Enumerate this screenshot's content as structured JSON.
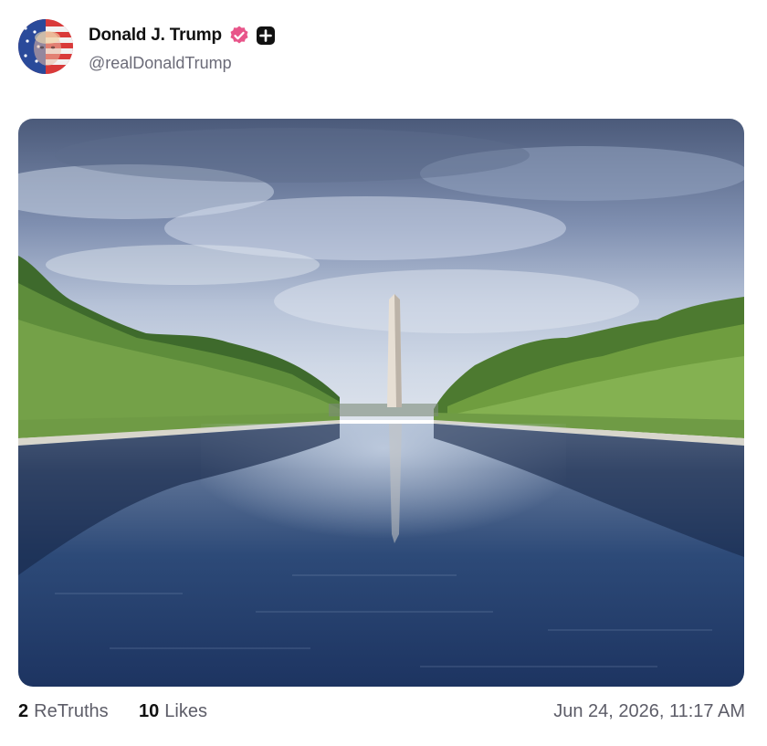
{
  "post": {
    "author": {
      "display_name": "Donald J. Trump",
      "handle": "@realDonaldTrump",
      "verified_badge_color": "#e8558a",
      "avatar_icon": "flag-portrait-avatar"
    },
    "media": {
      "alt": "Washington Monument reflected in the Lincoln Memorial Reflecting Pool"
    },
    "stats": {
      "retruths_count": "2",
      "retruths_label": "ReTruths",
      "likes_count": "10",
      "likes_label": "Likes"
    },
    "timestamp": "Jun 24, 2026, 11:17 AM"
  },
  "colors": {
    "accent_pink": "#e8558a",
    "text_primary": "#111111",
    "text_secondary": "#6b6b78"
  }
}
